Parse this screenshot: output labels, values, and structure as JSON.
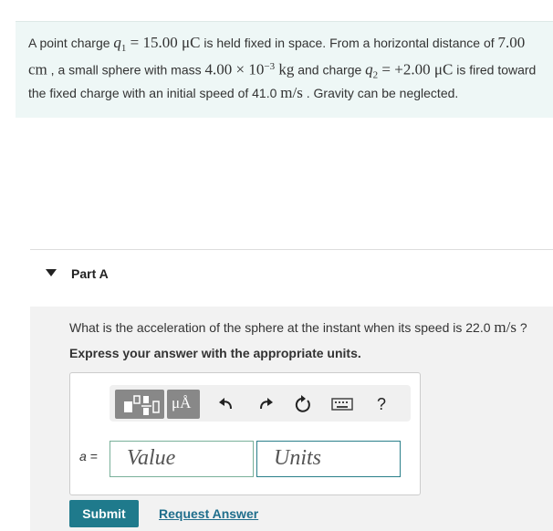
{
  "problem": {
    "p1": "A point charge ",
    "q1_sym": "q",
    "q1_sub": "1",
    "q1_eq": " = 15.00 μC",
    "p2": " is held fixed in space. From a horizontal distance of ",
    "dist": "7.00 cm",
    "p3": " , a small sphere with mass ",
    "mass": "4.00 × 10",
    "mass_exp": "−3",
    "mass_unit": " kg",
    "p4": " and charge ",
    "q2_sym": "q",
    "q2_sub": "2",
    "q2_eq": " = +2.00 μC",
    "p5": " is fired toward the fixed charge with an initial speed of 41.0 ",
    "speed_unit": "m/s",
    "p6": " . Gravity can be neglected."
  },
  "part": {
    "title": "Part A",
    "question_text": "What is the acceleration of the sphere at the instant when its speed is 22.0 ",
    "question_unit": "m/s",
    "question_end": " ?",
    "instruction": "Express your answer with the appropriate units."
  },
  "toolbar": {
    "units_button_label": "μÅ",
    "help_label": "?"
  },
  "answer": {
    "variable_label": "a =",
    "value_placeholder": "Value",
    "units_placeholder": "Units"
  },
  "actions": {
    "submit_label": "Submit",
    "request_label": "Request Answer"
  }
}
